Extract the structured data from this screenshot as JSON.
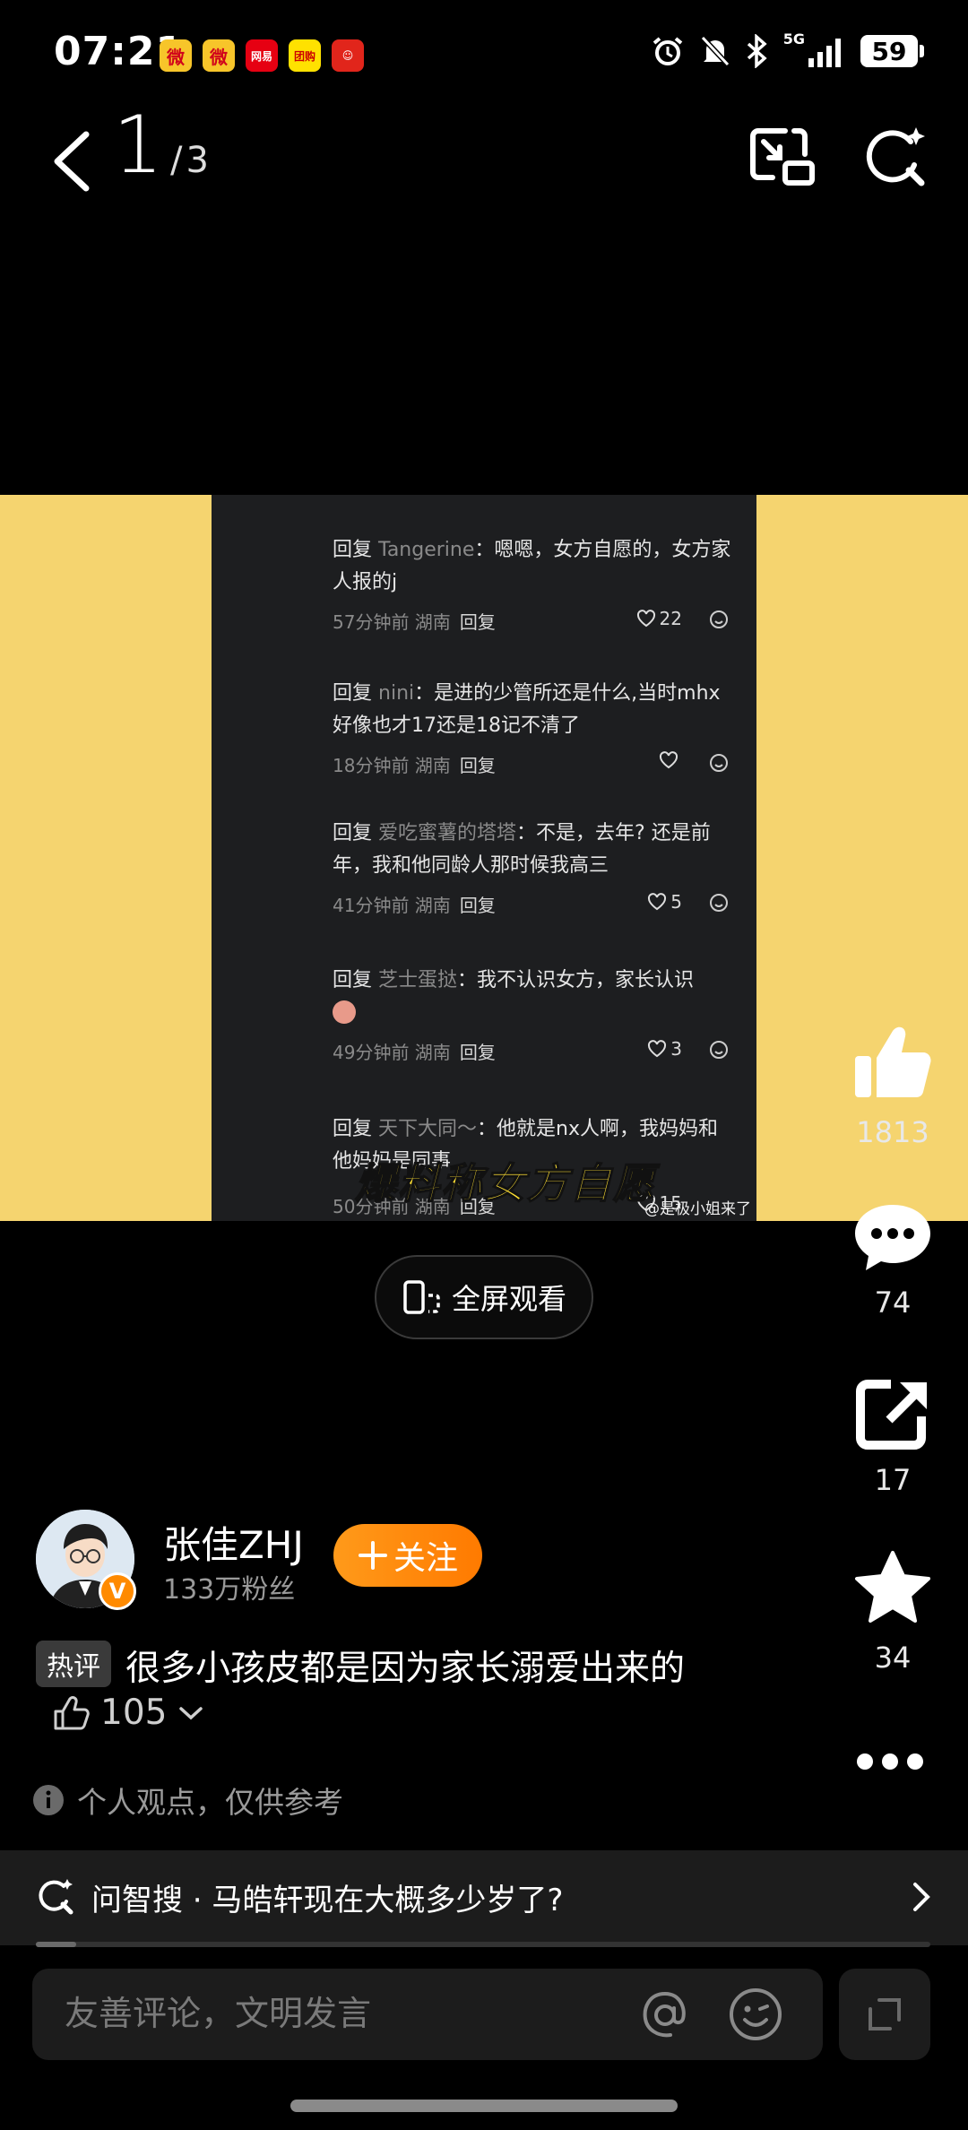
{
  "status_bar": {
    "time": "07:21",
    "app_icons": [
      {
        "name": "weibo-notification-icon",
        "glyph": "微"
      },
      {
        "name": "weibo-notification-icon-2",
        "glyph": "微"
      },
      {
        "name": "netease-notification-icon",
        "glyph": "网易"
      },
      {
        "name": "app-notification-icon",
        "glyph": "团购"
      },
      {
        "name": "app-notification-icon-2",
        "glyph": "☺"
      }
    ],
    "network": "5G",
    "battery": "59"
  },
  "nav": {
    "page_current": "1",
    "page_separator": "/",
    "page_total": "3"
  },
  "media": {
    "comments": [
      {
        "reply_word": "回复",
        "user": "Tangerine",
        "text": "：嗯嗯，女方自愿的，女方家人报的j",
        "meta": "57分钟前 湖南",
        "reply_label": "回复",
        "likes": "22"
      },
      {
        "reply_word": "回复",
        "user": "nini",
        "text": "：是进的少管所还是什么,当时mhx好像也才17还是18记不清了",
        "meta": "18分钟前 湖南",
        "reply_label": "回复",
        "likes": ""
      },
      {
        "reply_word": "回复",
        "user": "爱吃蜜薯的塔塔",
        "text": "：不是，去年? 还是前年，我和他同龄人那时候我高三",
        "meta": "41分钟前 湖南",
        "reply_label": "回复",
        "likes": "5"
      },
      {
        "reply_word": "回复",
        "user": "芝士蛋挞",
        "text": "：我不认识女方，家长认识",
        "meta": "49分钟前 湖南",
        "reply_label": "回复",
        "likes": "3"
      },
      {
        "reply_word": "回复",
        "user": "天下大同～",
        "text": "：他就是nx人啊，我妈妈和他妈妈是同事",
        "meta": "50分钟前 湖南",
        "reply_label": "回复",
        "likes": "15"
      }
    ],
    "caption": "爆料称女方自愿",
    "watermark": "@是极小姐来了"
  },
  "fullscreen": {
    "label": "全屏观看"
  },
  "rail": {
    "likes": "1813",
    "comments": "74",
    "shares": "17",
    "favorites": "34"
  },
  "author": {
    "name": "张佳ZHJ",
    "fans": "133万粉丝",
    "follow_label": "关注",
    "verify_badge": "V"
  },
  "hot_comment": {
    "tag": "热评",
    "text": "很多小孩皮都是因为家长溺爱出来的",
    "likes": "105"
  },
  "disclaimer": "个人观点，仅供参考",
  "smart_search": {
    "text": "问智搜 · 马皓轩现在大概多少岁了?",
    "progress": 0.045
  },
  "comment_input": {
    "placeholder": "友善评论，文明发言"
  },
  "colors": {
    "accent_orange": "#ff8a00",
    "media_side_yellow": "#f5d46f",
    "caption_yellow": "#ffe033"
  }
}
